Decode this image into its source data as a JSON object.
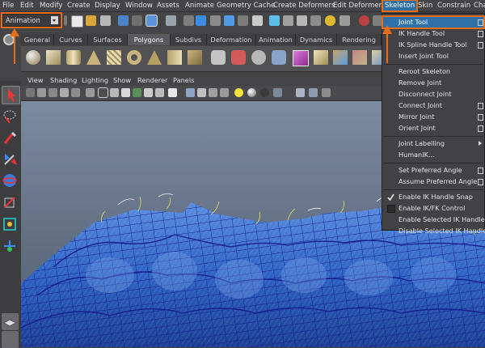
{
  "menubar": {
    "items": [
      "File",
      "Edit",
      "Modify",
      "Create",
      "Display",
      "Window",
      "Assets",
      "Animate",
      "Geometry Cache",
      "Create Deformers",
      "Edit Deformers",
      "Skeleton",
      "Skin",
      "Constrain",
      "Cha"
    ],
    "active": "Skeleton"
  },
  "statusline": {
    "mode": "Animation"
  },
  "shelf_tabs": {
    "items": [
      "General",
      "Curves",
      "Surfaces",
      "Polygons",
      "Subdivs",
      "Deformation",
      "Animation",
      "Dynamics",
      "Rendering"
    ],
    "active": "Polygons"
  },
  "panel_menu": {
    "items": [
      "View",
      "Shading",
      "Lighting",
      "Show",
      "Renderer",
      "Panels"
    ]
  },
  "skeleton_menu": {
    "items": [
      {
        "label": "Joint Tool",
        "highlighted": true,
        "option_box": true
      },
      {
        "label": "IK Handle Tool",
        "option_box": true
      },
      {
        "label": "IK Spline Handle Tool",
        "option_box": true
      },
      {
        "label": "Insert Joint Tool"
      },
      {
        "separator": true
      },
      {
        "label": "Reroot Skeleton"
      },
      {
        "label": "Remove Joint"
      },
      {
        "label": "Disconnect Joint"
      },
      {
        "label": "Connect Joint",
        "option_box": true
      },
      {
        "label": "Mirror Joint",
        "option_box": true
      },
      {
        "label": "Orient Joint",
        "option_box": true
      },
      {
        "separator": true
      },
      {
        "label": "Joint Labelling",
        "submenu": true
      },
      {
        "label": "HumanIK..."
      },
      {
        "separator": true
      },
      {
        "label": "Set Preferred Angle",
        "option_box": true
      },
      {
        "label": "Assume Preferred Angle",
        "option_box": true
      },
      {
        "separator": true
      },
      {
        "label": "Enable IK Handle Snap",
        "checked": true
      },
      {
        "label": "Enable IK/FK Control",
        "checked": false
      },
      {
        "label": "Enable Selected IK Handles"
      },
      {
        "label": "Disable Selected IK Handles"
      }
    ]
  },
  "colors": {
    "accent_highlight": "#e86d16",
    "selection_blue": "#2f72aa",
    "mesh_blue": "#3a6ccc",
    "wire": "#1a1f9a"
  },
  "icons": [
    "status-line-icons",
    "shelf-polygon-primitive-icons",
    "select-tool-icon",
    "lasso-tool-icon",
    "paint-select-icon",
    "move-tool-icon",
    "rotate-tool-icon",
    "scale-tool-icon",
    "universal-manipulator-icon",
    "soft-mod-icon",
    "layout-icon"
  ]
}
